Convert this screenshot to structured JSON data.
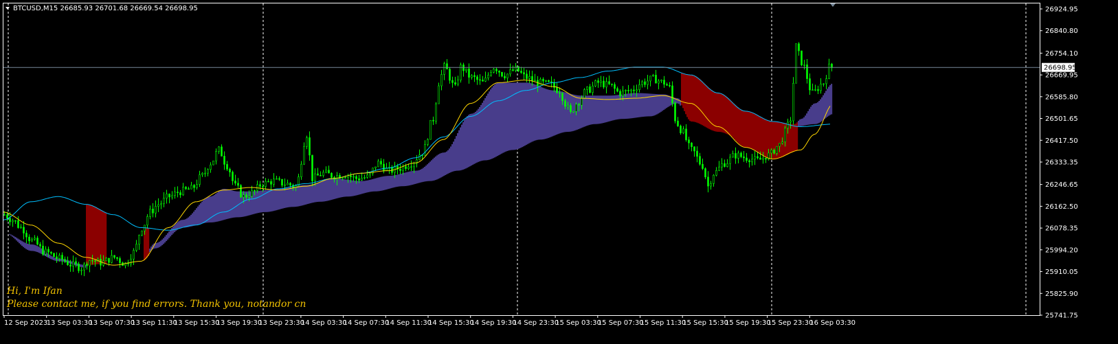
{
  "header": {
    "symbol_line": "BTCUSD,M15  26685.93 26701.68 26669.54 26698.95"
  },
  "notes": {
    "line1": "Hi, I'm Ifan",
    "line2": "Please contact me, if you find errors. Thank you, notandor cn"
  },
  "colors": {
    "background": "#000000",
    "frame": "#ffffff",
    "candle": "#00ff00",
    "cloud_up": "#483d8b",
    "cloud_down": "#8b0000",
    "ma_fast": "#ffd700",
    "ma_slow": "#00bfff",
    "price_line": "#778899",
    "note": "#f2c200"
  },
  "chart_data": {
    "type": "line",
    "symbol": "BTCUSD",
    "timeframe": "M15",
    "ohlc_last": {
      "open": 26685.93,
      "high": 26701.68,
      "low": 26669.54,
      "close": 26698.95
    },
    "current_price": 26698.95,
    "current_price_label": "26698.95",
    "ylim": [
      25741.75,
      26924.95
    ],
    "y_ticks": [
      "26924.95",
      "26840.80",
      "26754.10",
      "26669.95",
      "26585.80",
      "26501.65",
      "26417.50",
      "26333.35",
      "26246.65",
      "26162.50",
      "26078.35",
      "25994.20",
      "25910.05",
      "25825.90",
      "25741.75"
    ],
    "x_ticks": [
      "12 Sep 2023",
      "13 Sep 03:30",
      "13 Sep 07:30",
      "13 Sep 11:30",
      "13 Sep 15:30",
      "13 Sep 19:30",
      "13 Sep 23:30",
      "14 Sep 03:30",
      "14 Sep 07:30",
      "14 Sep 11:30",
      "14 Sep 15:30",
      "14 Sep 19:30",
      "14 Sep 23:30",
      "15 Sep 03:30",
      "15 Sep 07:30",
      "15 Sep 11:30",
      "15 Sep 15:30",
      "15 Sep 19:30",
      "15 Sep 23:30",
      "16 Sep 03:30"
    ],
    "day_separators": [
      "13 Sep 00:00",
      "14 Sep 00:00",
      "15 Sep 00:00",
      "16 Sep 00:00"
    ],
    "series": [
      {
        "role": "price_high",
        "t": [
          0,
          4,
          8,
          12,
          16,
          20,
          24,
          28,
          32,
          36,
          40,
          44,
          48,
          52,
          56,
          60,
          64,
          68,
          72,
          76,
          80,
          84,
          88,
          92,
          96,
          100,
          104,
          108,
          112,
          116,
          120,
          124,
          128,
          132,
          136,
          140,
          144,
          148,
          152,
          156,
          160,
          164,
          168,
          172,
          176,
          180,
          184,
          188,
          192,
          196,
          200,
          204,
          208,
          212,
          216,
          220,
          224,
          228,
          232,
          236,
          240,
          244,
          248,
          252,
          256,
          260,
          264,
          268,
          272,
          276,
          280,
          284,
          288,
          292,
          296,
          300,
          304,
          308,
          312,
          316,
          320,
          324,
          328,
          332,
          336,
          340,
          344,
          348,
          352,
          356,
          360,
          364,
          368,
          372,
          376,
          380,
          384,
          388,
          392,
          396,
          400,
          404,
          408,
          412,
          416,
          420,
          424,
          428,
          432,
          436,
          440,
          444,
          448,
          452,
          456,
          460,
          464,
          468,
          472,
          476,
          480,
          484,
          488,
          492,
          496,
          500,
          504,
          508,
          512,
          516,
          520,
          524,
          528,
          532,
          536,
          540,
          544,
          548,
          552,
          556,
          560,
          564,
          568,
          572,
          576,
          580,
          584,
          588,
          592,
          596,
          600,
          604,
          608,
          612,
          616,
          620,
          624,
          628,
          632,
          636,
          640,
          644,
          648,
          652,
          656,
          660,
          664,
          668,
          672,
          676,
          680,
          684,
          688,
          692,
          696,
          700,
          704,
          708,
          712,
          716,
          720,
          724,
          728,
          732,
          736,
          740,
          744,
          748,
          752,
          756,
          760,
          764,
          768,
          772,
          776,
          780,
          784,
          788,
          792,
          796,
          800,
          804,
          808,
          812,
          816,
          820,
          824,
          828,
          832,
          836,
          840,
          844,
          848,
          852,
          856,
          860,
          864,
          868,
          872,
          876,
          880,
          884,
          888,
          892,
          896,
          900,
          904,
          908,
          912,
          916,
          920,
          924,
          928,
          932,
          936,
          940,
          944,
          948,
          952,
          956,
          960,
          964,
          968,
          972,
          976,
          980,
          984,
          988,
          992,
          996,
          1000,
          1004,
          1008,
          1012,
          1016,
          1020,
          1024,
          1028,
          1032,
          1036,
          1040,
          1044,
          1048,
          1052,
          1056,
          1060,
          1064,
          1068,
          1072,
          1076,
          1080,
          1084,
          1088,
          1092,
          1096,
          1100,
          1104,
          1108,
          1112,
          1116,
          1120,
          1124,
          1128,
          1132,
          1136,
          1140,
          1144,
          1148,
          1152,
          1156,
          1160,
          1164,
          1168,
          1172,
          1176,
          1180,
          1184,
          1188,
          1192,
          1196,
          1200,
          1204,
          1208
        ],
        "values": []
      }
    ],
    "keyframes": {
      "close": [
        [
          0,
          26130
        ],
        [
          12,
          26110
        ],
        [
          24,
          26080
        ],
        [
          40,
          26030
        ],
        [
          60,
          25985
        ],
        [
          80,
          25960
        ],
        [
          100,
          25935
        ],
        [
          112,
          25925
        ],
        [
          124,
          25955
        ],
        [
          140,
          25945
        ],
        [
          160,
          25965
        ],
        [
          176,
          25940
        ],
        [
          188,
          25985
        ],
        [
          200,
          26080
        ],
        [
          212,
          26140
        ],
        [
          224,
          26170
        ],
        [
          240,
          26200
        ],
        [
          256,
          26220
        ],
        [
          272,
          26230
        ],
        [
          288,
          26280
        ],
        [
          300,
          26330
        ],
        [
          312,
          26380
        ],
        [
          324,
          26320
        ],
        [
          336,
          26240
        ],
        [
          348,
          26200
        ],
        [
          360,
          26215
        ],
        [
          376,
          26250
        ],
        [
          392,
          26260
        ],
        [
          408,
          26250
        ],
        [
          424,
          26240
        ],
        [
          440,
          26440
        ],
        [
          448,
          26270
        ],
        [
          464,
          26290
        ],
        [
          480,
          26280
        ],
        [
          496,
          26285
        ],
        [
          512,
          26270
        ],
        [
          528,
          26275
        ],
        [
          544,
          26330
        ],
        [
          560,
          26300
        ],
        [
          576,
          26310
        ],
        [
          592,
          26330
        ],
        [
          608,
          26370
        ],
        [
          624,
          26500
        ],
        [
          632,
          26640
        ],
        [
          640,
          26700
        ],
        [
          656,
          26620
        ],
        [
          664,
          26700
        ],
        [
          680,
          26660
        ],
        [
          696,
          26640
        ],
        [
          712,
          26700
        ],
        [
          728,
          26670
        ],
        [
          744,
          26690
        ],
        [
          760,
          26660
        ],
        [
          776,
          26640
        ],
        [
          792,
          26635
        ],
        [
          808,
          26610
        ],
        [
          816,
          26560
        ],
        [
          824,
          26520
        ],
        [
          832,
          26560
        ],
        [
          848,
          26610
        ],
        [
          864,
          26640
        ],
        [
          880,
          26630
        ],
        [
          896,
          26600
        ],
        [
          912,
          26610
        ],
        [
          928,
          26640
        ],
        [
          944,
          26655
        ],
        [
          960,
          26640
        ],
        [
          968,
          26620
        ],
        [
          976,
          26500
        ],
        [
          984,
          26460
        ],
        [
          1000,
          26380
        ],
        [
          1016,
          26320
        ],
        [
          1024,
          26240
        ],
        [
          1032,
          26290
        ],
        [
          1048,
          26330
        ],
        [
          1064,
          26360
        ],
        [
          1080,
          26350
        ],
        [
          1096,
          26340
        ],
        [
          1112,
          26360
        ],
        [
          1128,
          26400
        ],
        [
          1136,
          26450
        ],
        [
          1144,
          26500
        ],
        [
          1152,
          26780
        ],
        [
          1160,
          26720
        ],
        [
          1176,
          26600
        ],
        [
          1192,
          26640
        ],
        [
          1200,
          26700
        ],
        [
          1208,
          26699
        ]
      ],
      "ma_fast": [
        [
          0,
          26140
        ],
        [
          40,
          26090
        ],
        [
          80,
          26020
        ],
        [
          120,
          25965
        ],
        [
          160,
          25935
        ],
        [
          200,
          25950
        ],
        [
          240,
          26080
        ],
        [
          280,
          26180
        ],
        [
          320,
          26225
        ],
        [
          360,
          26235
        ],
        [
          400,
          26225
        ],
        [
          440,
          26240
        ],
        [
          480,
          26270
        ],
        [
          520,
          26290
        ],
        [
          560,
          26300
        ],
        [
          600,
          26330
        ],
        [
          640,
          26420
        ],
        [
          680,
          26560
        ],
        [
          720,
          26640
        ],
        [
          760,
          26650
        ],
        [
          800,
          26625
        ],
        [
          840,
          26580
        ],
        [
          880,
          26575
        ],
        [
          920,
          26580
        ],
        [
          960,
          26590
        ],
        [
          1000,
          26560
        ],
        [
          1040,
          26470
        ],
        [
          1080,
          26390
        ],
        [
          1120,
          26345
        ],
        [
          1160,
          26380
        ],
        [
          1180,
          26440
        ],
        [
          1208,
          26560
        ]
      ],
      "ma_slow": [
        [
          0,
          26110
        ],
        [
          40,
          26180
        ],
        [
          80,
          26200
        ],
        [
          120,
          26170
        ],
        [
          160,
          26130
        ],
        [
          200,
          26080
        ],
        [
          240,
          26070
        ],
        [
          280,
          26090
        ],
        [
          320,
          26140
        ],
        [
          360,
          26190
        ],
        [
          400,
          26230
        ],
        [
          440,
          26250
        ],
        [
          480,
          26270
        ],
        [
          520,
          26290
        ],
        [
          560,
          26310
        ],
        [
          600,
          26350
        ],
        [
          640,
          26430
        ],
        [
          680,
          26510
        ],
        [
          720,
          26570
        ],
        [
          760,
          26610
        ],
        [
          800,
          26640
        ],
        [
          840,
          26660
        ],
        [
          880,
          26685
        ],
        [
          920,
          26700
        ],
        [
          960,
          26700
        ],
        [
          1000,
          26670
        ],
        [
          1040,
          26600
        ],
        [
          1080,
          26530
        ],
        [
          1120,
          26490
        ],
        [
          1160,
          26470
        ],
        [
          1208,
          26480
        ]
      ],
      "cloud_upper": [
        [
          0,
          26060
        ],
        [
          40,
          26015
        ],
        [
          80,
          25960
        ],
        [
          120,
          25935
        ],
        [
          160,
          25935
        ],
        [
          200,
          25960
        ],
        [
          220,
          26020
        ],
        [
          260,
          26110
        ],
        [
          300,
          26200
        ],
        [
          320,
          26230
        ],
        [
          340,
          26220
        ],
        [
          360,
          26220
        ],
        [
          400,
          26230
        ],
        [
          440,
          26245
        ],
        [
          480,
          26270
        ],
        [
          520,
          26260
        ],
        [
          560,
          26280
        ],
        [
          600,
          26300
        ],
        [
          640,
          26370
        ],
        [
          680,
          26520
        ],
        [
          720,
          26640
        ],
        [
          760,
          26640
        ],
        [
          800,
          26610
        ],
        [
          840,
          26590
        ],
        [
          880,
          26590
        ],
        [
          920,
          26600
        ],
        [
          960,
          26595
        ],
        [
          980,
          26580
        ],
        [
          1000,
          26510
        ],
        [
          1040,
          26510
        ],
        [
          1080,
          26500
        ],
        [
          1120,
          26490
        ],
        [
          1150,
          26480
        ],
        [
          1160,
          26500
        ],
        [
          1180,
          26560
        ],
        [
          1208,
          26640
        ]
      ],
      "cloud_lower": [
        [
          0,
          26060
        ],
        [
          40,
          25990
        ],
        [
          80,
          25950
        ],
        [
          120,
          25925
        ],
        [
          160,
          25935
        ],
        [
          200,
          25960
        ],
        [
          220,
          26000
        ],
        [
          260,
          26080
        ],
        [
          300,
          26100
        ],
        [
          340,
          26120
        ],
        [
          380,
          26140
        ],
        [
          420,
          26160
        ],
        [
          460,
          26180
        ],
        [
          500,
          26200
        ],
        [
          540,
          26220
        ],
        [
          580,
          26240
        ],
        [
          620,
          26260
        ],
        [
          660,
          26300
        ],
        [
          700,
          26340
        ],
        [
          740,
          26380
        ],
        [
          780,
          26420
        ],
        [
          820,
          26450
        ],
        [
          860,
          26480
        ],
        [
          900,
          26500
        ],
        [
          940,
          26510
        ],
        [
          980,
          26560
        ],
        [
          1000,
          26480
        ],
        [
          1040,
          26440
        ],
        [
          1080,
          26400
        ],
        [
          1120,
          26360
        ],
        [
          1150,
          26470
        ],
        [
          1180,
          26480
        ],
        [
          1208,
          26520
        ]
      ]
    },
    "down_zones": [
      [
        120,
        210
      ],
      [
        985,
        1155
      ]
    ]
  }
}
